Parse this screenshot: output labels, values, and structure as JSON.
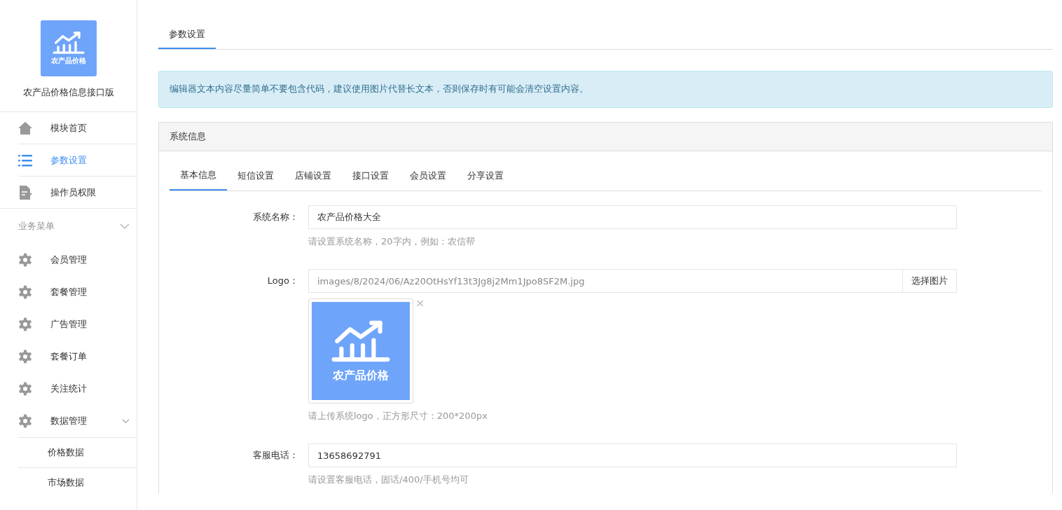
{
  "sidebar": {
    "logo_text": "农产品价格",
    "app_name": "农产品价格信息接口版",
    "top_items": [
      {
        "label": "模块首页",
        "kind": "home",
        "selected": false
      },
      {
        "label": "参数设置",
        "kind": "list",
        "selected": true
      },
      {
        "label": "操作员权限",
        "kind": "doc",
        "selected": false
      }
    ],
    "section": {
      "label": "业务菜单",
      "expanded": true
    },
    "items": [
      {
        "label": "会员管理"
      },
      {
        "label": "套餐管理"
      },
      {
        "label": "广告管理"
      },
      {
        "label": "套餐订单"
      },
      {
        "label": "关注统计"
      },
      {
        "label": "数据管理",
        "expanded": true,
        "children": [
          {
            "label": "价格数据"
          },
          {
            "label": "市场数据"
          }
        ]
      }
    ]
  },
  "page_tabs": [
    {
      "label": "参数设置",
      "selected": true
    }
  ],
  "alert": "编辑器文本内容尽量简单不要包含代码，建议使用图片代替长文本，否则保存时有可能会清空设置内容。",
  "panel": {
    "title": "系统信息",
    "tabs": [
      {
        "label": "基本信息",
        "selected": true
      },
      {
        "label": "短信设置",
        "selected": false
      },
      {
        "label": "店铺设置",
        "selected": false
      },
      {
        "label": "接口设置",
        "selected": false
      },
      {
        "label": "会员设置",
        "selected": false
      },
      {
        "label": "分享设置",
        "selected": false
      }
    ],
    "fields": [
      {
        "kind": "text",
        "label": "系统名称：",
        "value": "农产品价格大全",
        "help": "请设置系统名称，20字内，例如：农信帮"
      },
      {
        "kind": "image",
        "label": "Logo：",
        "value": "images/8/2024/06/Az20OtHsYf13t3Jg8j2Mm1Jpo8SF2M.jpg",
        "button": "选择图片",
        "preview_text": "农产品价格",
        "remove": "×",
        "help": "请上传系统logo，正方形尺寸：200*200px"
      },
      {
        "kind": "text",
        "label": "客服电话：",
        "value": "13658692791",
        "help": "请设置客服电话，固话/400/手机号均可"
      }
    ]
  }
}
